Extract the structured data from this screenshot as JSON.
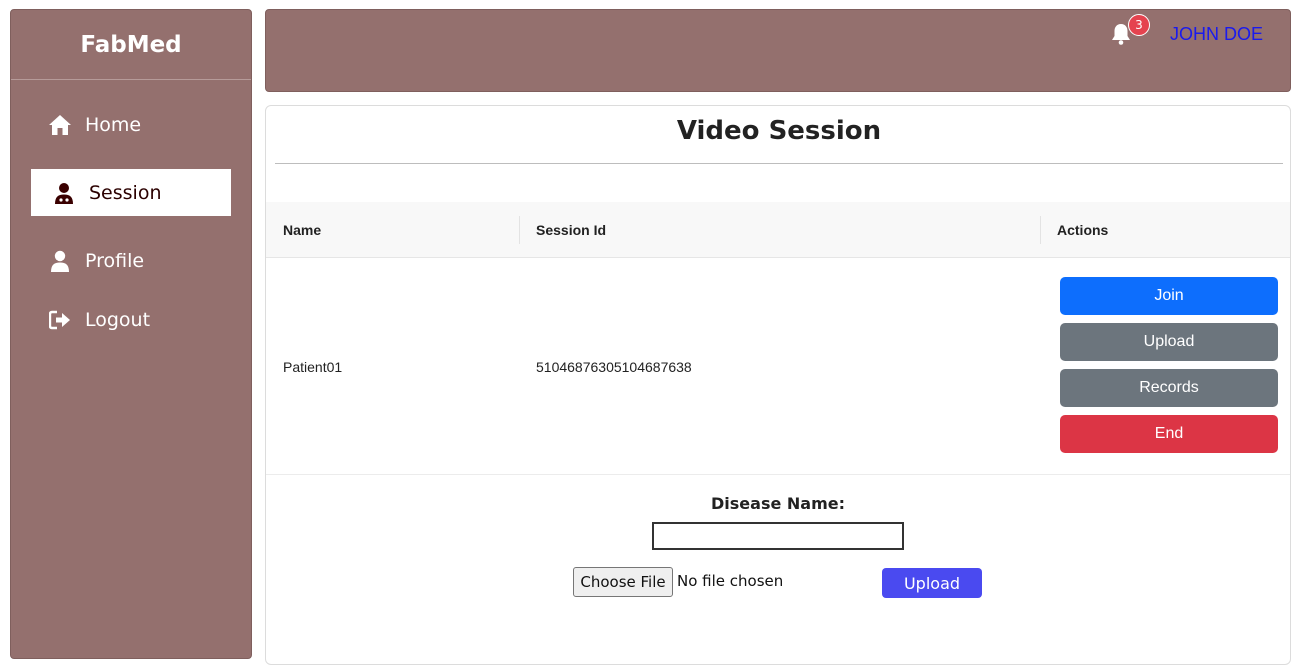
{
  "app": {
    "brand": "FabMed"
  },
  "sidebar": {
    "items": [
      {
        "label": "Home",
        "icon": "home-icon"
      },
      {
        "label": "Session",
        "icon": "doctor-icon",
        "active": true
      },
      {
        "label": "Profile",
        "icon": "user-icon"
      },
      {
        "label": "Logout",
        "icon": "logout-icon"
      }
    ]
  },
  "header": {
    "notification_count": "3",
    "user_name": "JOHN DOE"
  },
  "main": {
    "title": "Video Session",
    "table": {
      "columns": [
        "Name",
        "Session Id",
        "Actions"
      ],
      "rows": [
        {
          "name": "Patient01",
          "session_id": "51046876305104687638"
        }
      ],
      "actions": [
        {
          "label": "Join",
          "color": "#0d6efd"
        },
        {
          "label": "Upload",
          "color": "#6c757d"
        },
        {
          "label": "Records",
          "color": "#6c757d"
        },
        {
          "label": "End",
          "color": "#dc3545"
        }
      ]
    },
    "form": {
      "disease_label": "Disease Name:",
      "disease_value": "",
      "choose_file_label": "Choose File",
      "file_status": "No file chosen",
      "upload_label": "Upload"
    }
  },
  "colors": {
    "sidebar_bg": "#94706e",
    "accent_blue": "#0d6efd",
    "upload_purple": "#4a4af0",
    "badge_red": "#e5434f",
    "user_link": "#1a1aee"
  }
}
